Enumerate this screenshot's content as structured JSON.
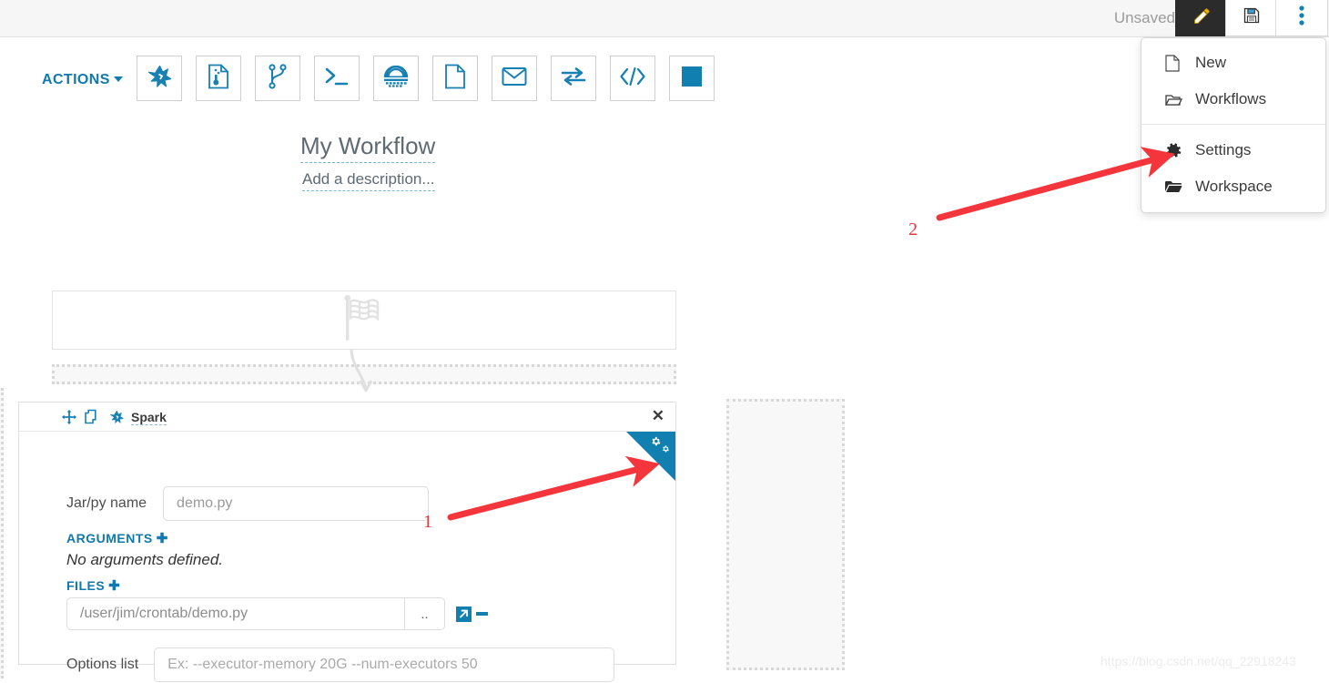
{
  "topbar": {
    "unsaved_label": "Unsaved",
    "buttons": [
      {
        "name": "edit-button",
        "icon": "pencil-icon",
        "active": true
      },
      {
        "name": "save-button",
        "icon": "floppy-disk-icon",
        "active": false
      },
      {
        "name": "more-button",
        "icon": "vertical-dots-icon",
        "active": false
      }
    ]
  },
  "dropdown": {
    "items": [
      {
        "label": "New",
        "icon": "file-icon"
      },
      {
        "label": "Workflows",
        "icon": "folder-open-icon"
      },
      {
        "label": "Settings",
        "icon": "gear-icon"
      },
      {
        "label": "Workspace",
        "icon": "folder-icon"
      }
    ]
  },
  "toolbar": {
    "actions_label": "ACTIONS",
    "items": [
      {
        "name": "spark-action",
        "icon": "spark-star-icon"
      },
      {
        "name": "pig-action",
        "icon": "document-script-icon"
      },
      {
        "name": "git-action",
        "icon": "git-branch-icon"
      },
      {
        "name": "shell-action",
        "icon": "terminal-icon"
      },
      {
        "name": "hive-action",
        "icon": "hive-bee-icon"
      },
      {
        "name": "file-action",
        "icon": "blank-page-icon"
      },
      {
        "name": "email-action",
        "icon": "envelope-icon"
      },
      {
        "name": "sqoop-action",
        "icon": "transfer-arrows-icon"
      },
      {
        "name": "code-action",
        "icon": "angle-brackets-icon"
      },
      {
        "name": "stop-action",
        "icon": "filled-square-icon"
      }
    ]
  },
  "canvas": {
    "workflow_title": "My Workflow",
    "workflow_description": "Add a description...",
    "start_node_icon": "checkered-flag-icon"
  },
  "spark_node": {
    "header": {
      "title": "Spark",
      "move_icon": "move-arrows-icon",
      "copy_icon": "copy-icon",
      "type_icon": "spark-star-icon",
      "close_label": "✕"
    },
    "corner_settings_icon": "gears-icon",
    "jar_label": "Jar/py name",
    "jar_value": "demo.py",
    "arguments_label": "ARGUMENTS",
    "arguments_add": "✚",
    "no_arguments_text": "No arguments defined.",
    "files_label": "FILES",
    "files_add": "✚",
    "file_value": "/user/jim/crontab/demo.py",
    "browse_label": "..",
    "open_icon": "external-link-icon",
    "remove_icon": "minus-icon",
    "options_label": "Options list",
    "options_placeholder": "Ex: --executor-memory 20G --num-executors 50"
  },
  "annotations": {
    "marker_1": "1",
    "marker_2": "2",
    "arrow_color": "#f4363c"
  },
  "watermark": "https://blog.csdn.net/qq_22918243",
  "colors": {
    "accent_blue": "#1180b0",
    "link_blue": "#1079ad",
    "topbar_bg": "#f6f6f6",
    "active_button_bg": "#2b2b2b"
  }
}
